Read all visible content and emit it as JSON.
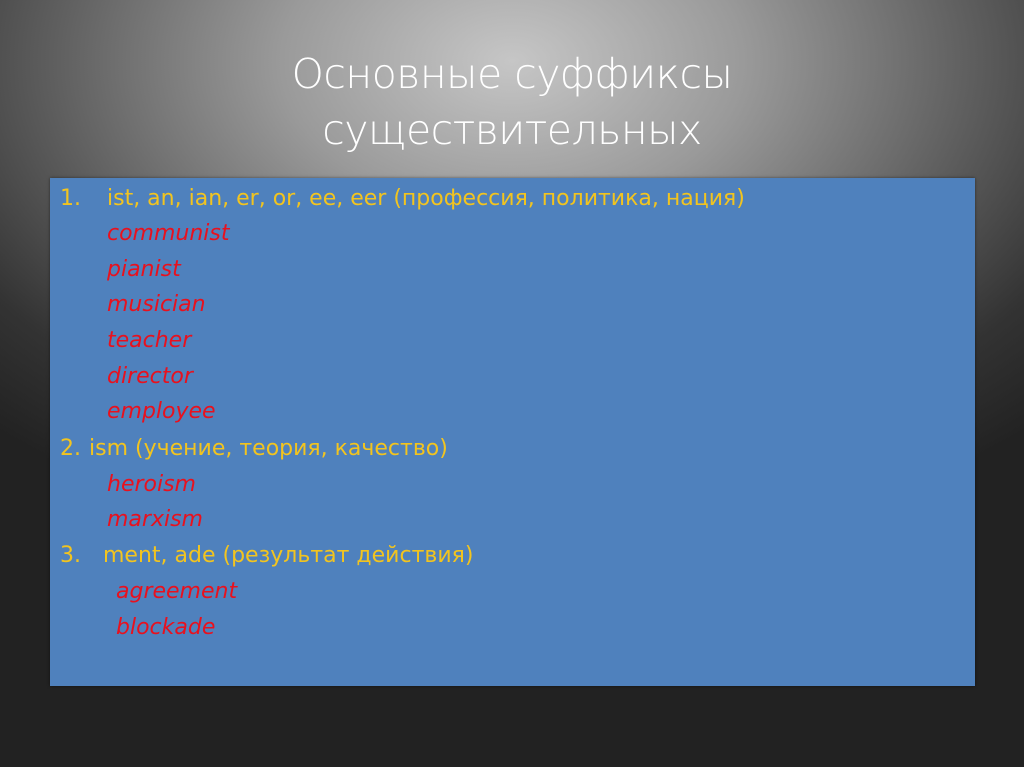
{
  "slide": {
    "title_line1": "Основные суффиксы",
    "title_line2": "существительных",
    "colors": {
      "box": "#4f81bd",
      "heading_text": "#f2c41f",
      "example_text": "#e8111e",
      "title_text": "#ffffff"
    },
    "groups": [
      {
        "number": "1.",
        "heading": "ist, an, ian, er, or, ee, eer (профессия, политика, нация)",
        "examples": [
          "communist",
          "pianist",
          "musician",
          "teacher",
          "director",
          "employee"
        ]
      },
      {
        "number": "2.",
        "heading": "ism (учение, теория, качество)",
        "examples": [
          "heroism",
          "marxism"
        ]
      },
      {
        "number": "3.",
        "heading": "ment, ade (результат действия)",
        "examples": [
          "agreement",
          "blockade"
        ]
      }
    ]
  }
}
